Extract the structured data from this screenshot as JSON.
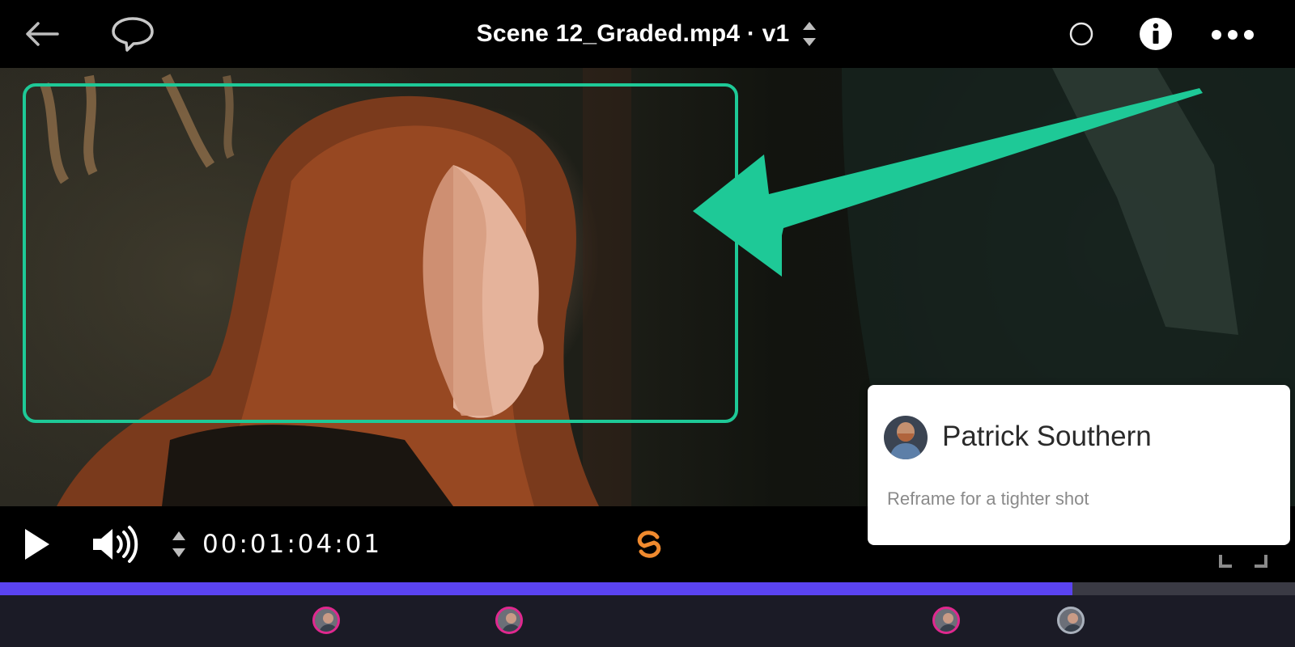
{
  "header": {
    "file_name": "Scene 12_Graded.mp4",
    "version": "v1",
    "title_separator": " · ",
    "back_icon": "arrow-left-icon",
    "comments_icon": "speech-bubble-icon",
    "version_stepper_icon": "up-down-chevrons-icon",
    "status_icon": "circle-outline-icon",
    "info_icon": "info-icon",
    "more_icon": "ellipsis-icon"
  },
  "annotation": {
    "color": "#1ec997",
    "shapes": [
      "rectangle",
      "arrow"
    ]
  },
  "controls": {
    "timecode": "00:01:04:01",
    "play_icon": "play-icon",
    "volume_icon": "volume-icon",
    "timecode_stepper_icon": "up-down-chevrons-icon",
    "sync_icon": "sync-icon",
    "sync_color": "#f08a2e"
  },
  "progress": {
    "fraction_played": 0.828,
    "fill_color": "#5a43f0"
  },
  "timeline_markers": [
    {
      "kind": "comment-marker",
      "ring_color": "#e0288f"
    },
    {
      "kind": "comment-marker",
      "ring_color": "#e0288f"
    },
    {
      "kind": "comment-marker",
      "ring_color": "#e0288f"
    },
    {
      "kind": "comment-marker",
      "ring_color": "#a9b0bb"
    }
  ],
  "comment_popup": {
    "author": "Patrick Southern",
    "text": "Reframe for a tighter shot"
  }
}
